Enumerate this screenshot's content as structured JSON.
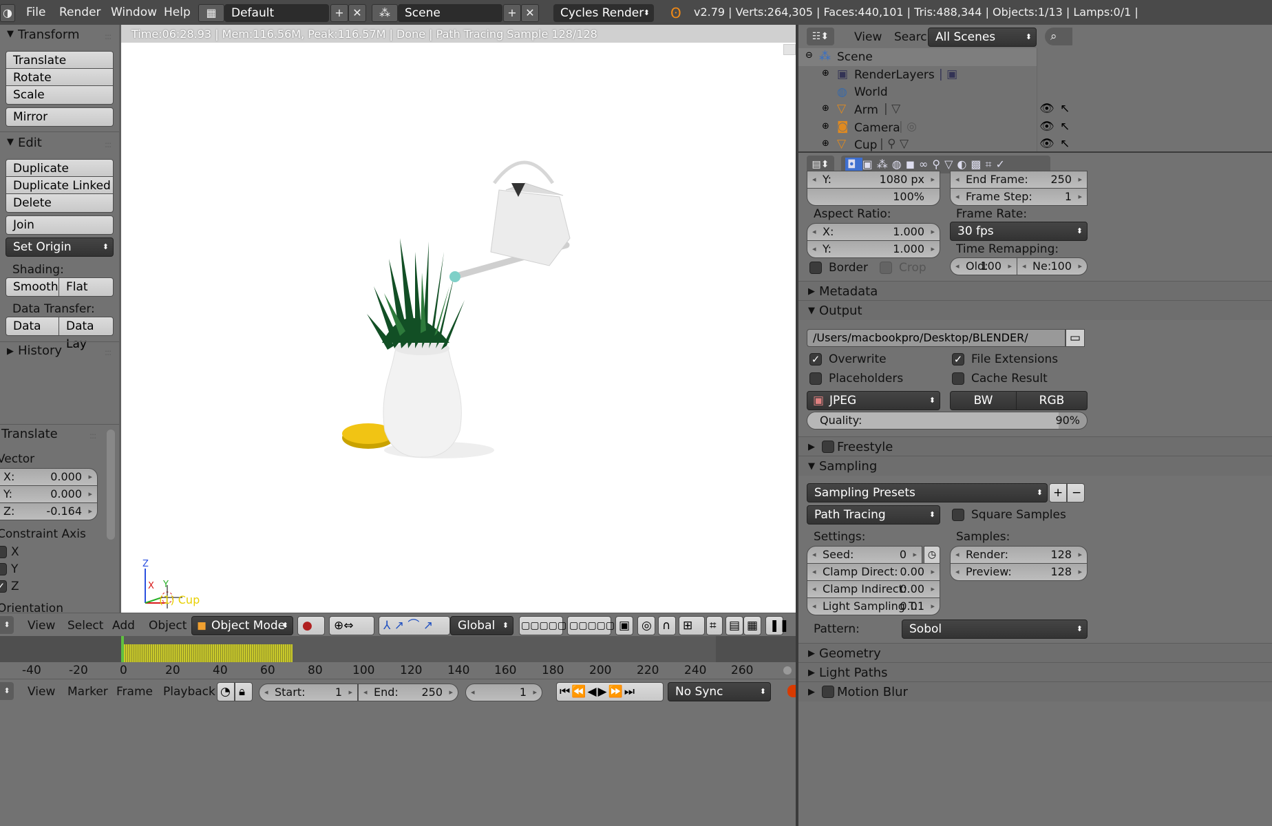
{
  "topbar": {
    "menus": [
      "File",
      "Render",
      "Window",
      "Help"
    ],
    "layout": "Default",
    "scene": "Scene",
    "engine": "Cycles Render",
    "stats": "v2.79 | Verts:264,305 | Faces:440,101 | Tris:488,344 | Objects:1/13 | Lamps:0/1 |"
  },
  "toolshelf": {
    "transform": {
      "title": "Transform",
      "buttons": [
        "Translate",
        "Rotate",
        "Scale"
      ],
      "mirror": "Mirror"
    },
    "edit": {
      "title": "Edit",
      "buttons": [
        "Duplicate",
        "Duplicate Linked",
        "Delete"
      ],
      "join": "Join",
      "set_origin": "Set Origin"
    },
    "shading": {
      "label": "Shading:",
      "smooth": "Smooth",
      "flat": "Flat"
    },
    "data_transfer": {
      "label": "Data Transfer:",
      "data": "Data",
      "data_lay": "Data Lay"
    },
    "history": "History"
  },
  "operator": {
    "title": "Translate",
    "vector_label": "Vector",
    "x": {
      "label": "X:",
      "value": "0.000"
    },
    "y": {
      "label": "Y:",
      "value": "0.000"
    },
    "z": {
      "label": "Z:",
      "value": "-0.164"
    },
    "constraint_label": "Constraint Axis",
    "axes": [
      "X",
      "Y",
      "Z"
    ],
    "orientation_label": "Orientation"
  },
  "viewport": {
    "render_info": "Time:06:28.93 | Mem:116.56M, Peak:116.57M | Done | Path Tracing Sample 128/128",
    "active_object": "(1) Cup",
    "axis_z": "Z",
    "axis_x": "X",
    "axis_y": "Y"
  },
  "view3d_header": {
    "menus": [
      "View",
      "Select",
      "Add",
      "Object"
    ],
    "mode": "Object Mode",
    "orientation": "Global"
  },
  "timeline": {
    "ticks": [
      "-40",
      "-20",
      "0",
      "20",
      "40",
      "60",
      "80",
      "100",
      "120",
      "140",
      "160",
      "180",
      "200",
      "220",
      "240",
      "260"
    ],
    "menus": [
      "View",
      "Marker",
      "Frame",
      "Playback"
    ],
    "start_label": "Start:",
    "start": "1",
    "end_label": "End:",
    "end": "250",
    "current": "1",
    "sync": "No Sync"
  },
  "outliner": {
    "menus": [
      "View",
      "Search"
    ],
    "filter": "All Scenes",
    "items": [
      "Scene",
      "RenderLayers",
      "World",
      "Arm",
      "Camera",
      "Cup"
    ]
  },
  "properties": {
    "res_y_label": "Y:",
    "res_y": "1080 px",
    "res_pct": "100%",
    "end_frame_label": "End Frame:",
    "end_frame": "250",
    "frame_step_label": "Frame Step:",
    "frame_step": "1",
    "aspect_label": "Aspect Ratio:",
    "aspect_x_label": "X:",
    "aspect_x": "1.000",
    "aspect_y_label": "Y:",
    "aspect_y": "1.000",
    "frame_rate_label": "Frame Rate:",
    "frame_rate": "30 fps",
    "time_remap_label": "Time Remapping:",
    "old_label": "Old:",
    "old": "100",
    "new_label": "Ne:",
    "new": "100",
    "border": "Border",
    "crop": "Crop",
    "metadata": "Metadata",
    "output": "Output",
    "output_path": "/Users/macbookpro/Desktop/BLENDER/",
    "overwrite": "Overwrite",
    "file_ext": "File Extensions",
    "placeholders": "Placeholders",
    "cache_result": "Cache Result",
    "format": "JPEG",
    "bw": "BW",
    "rgb": "RGB",
    "quality_label": "Quality:",
    "quality": "90%",
    "quality_fraction": 0.9,
    "freestyle": "Freestyle",
    "sampling": "Sampling",
    "sampling_presets": "Sampling Presets",
    "integrator": "Path Tracing",
    "square_samples": "Square Samples",
    "settings_label": "Settings:",
    "samples_label": "Samples:",
    "seed_label": "Seed:",
    "seed": "0",
    "render_label": "Render:",
    "render": "128",
    "clamp_direct_label": "Clamp Direct:",
    "clamp_direct": "0.00",
    "preview_label": "Preview:",
    "preview": "128",
    "clamp_indirect_label": "Clamp Indirect:",
    "clamp_indirect": "0.00",
    "light_sampling_label": "Light Sampling T:",
    "light_sampling": "0.01",
    "pattern_label": "Pattern:",
    "pattern": "Sobol",
    "geometry": "Geometry",
    "light_paths": "Light Paths",
    "motion_blur": "Motion Blur"
  }
}
